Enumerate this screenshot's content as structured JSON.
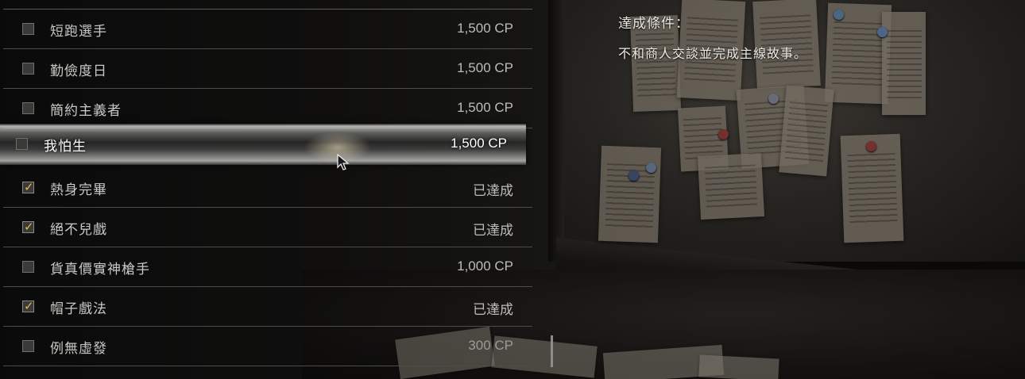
{
  "challenges": [
    {
      "label": "短跑選手",
      "value": "1,500 CP",
      "completed": false
    },
    {
      "label": "勤儉度日",
      "value": "1,500 CP",
      "completed": false
    },
    {
      "label": "簡約主義者",
      "value": "1,500 CP",
      "completed": false
    },
    {
      "label": "我怕生",
      "value": "1,500 CP",
      "completed": false,
      "selected": true
    },
    {
      "label": "熱身完畢",
      "value": "已達成",
      "completed": true
    },
    {
      "label": "絕不兒戲",
      "value": "已達成",
      "completed": true
    },
    {
      "label": "貨真價實神槍手",
      "value": "1,000 CP",
      "completed": false
    },
    {
      "label": "帽子戲法",
      "value": "已達成",
      "completed": true
    },
    {
      "label": "例無虛發",
      "value": "300 CP",
      "completed": false
    }
  ],
  "detail": {
    "title": "達成條件：",
    "description": "不和商人交談並完成主線故事。"
  },
  "colors": {
    "check_accent": "#e3b54d",
    "text_primary": "#c9c8c4",
    "divider": "#4d4c49"
  },
  "icons": {
    "checked": "checkmark-icon",
    "unchecked": "empty-checkbox-icon",
    "cursor": "mouse-cursor-icon"
  }
}
